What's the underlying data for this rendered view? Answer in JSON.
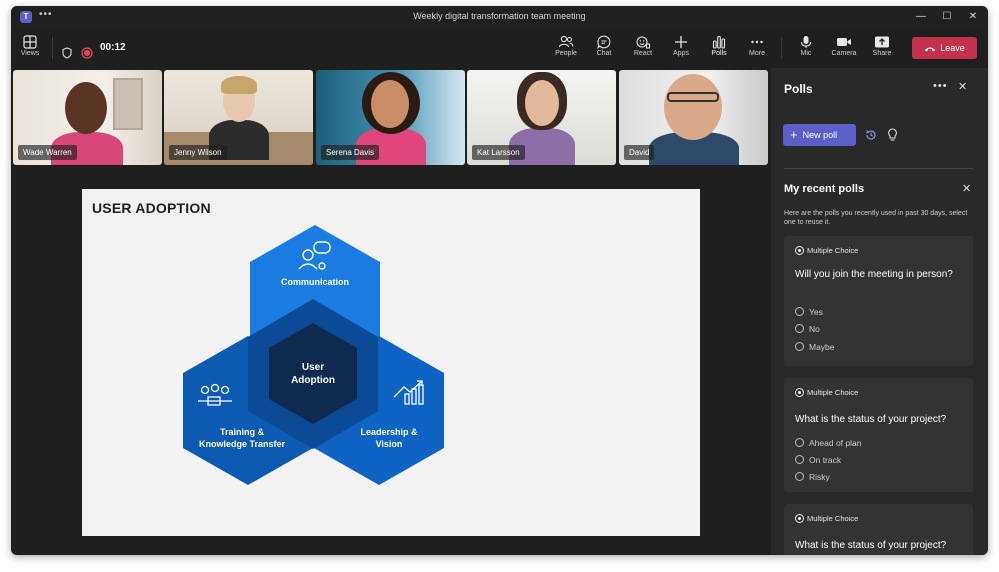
{
  "window": {
    "title": "Weekly digital transformation team meeting",
    "logo": "T"
  },
  "toolbar": {
    "views": "Views",
    "timer": "00:12",
    "people": "People",
    "chat": "Chat",
    "react": "React",
    "apps": "Apps",
    "polls": "Polls",
    "more": "More",
    "mic": "Mic",
    "camera": "Camera",
    "share": "Share",
    "leave": "Leave"
  },
  "participants": [
    {
      "name": "Wade Warren"
    },
    {
      "name": "Jenny Wilson"
    },
    {
      "name": "Serena Davis"
    },
    {
      "name": "Kat Larsson"
    },
    {
      "name": "David"
    }
  ],
  "slide": {
    "title": "USER ADOPTION",
    "center": [
      "User",
      "Adoption"
    ],
    "top": "Communication",
    "left": [
      "Training &",
      "Knowledge Transfer"
    ],
    "right": [
      "Leadership &",
      "Vision"
    ]
  },
  "panel": {
    "title": "Polls",
    "new_poll": "New poll",
    "recent_title": "My recent polls",
    "recent_desc": "Here are the polls you recently used in past 30 days, select one to reuse it.",
    "polls": [
      {
        "type": "Multiple Choice",
        "question": "Will you join the meeting in person?",
        "options": [
          "Yes",
          "No",
          "Maybe"
        ]
      },
      {
        "type": "Multiple Choice",
        "question": "What is the status of your project?",
        "options": [
          "Ahead of plan",
          "On track",
          "Risky"
        ]
      },
      {
        "type": "Multiple Choice",
        "question": "What is the status of your project?",
        "options": []
      }
    ]
  },
  "colors": {
    "accent": "#5b5fc7",
    "leave": "#c4314b",
    "hex_light": "#1a7be0",
    "hex_dark": "#0d5ab3",
    "hex_center": "#0f2a4f"
  }
}
